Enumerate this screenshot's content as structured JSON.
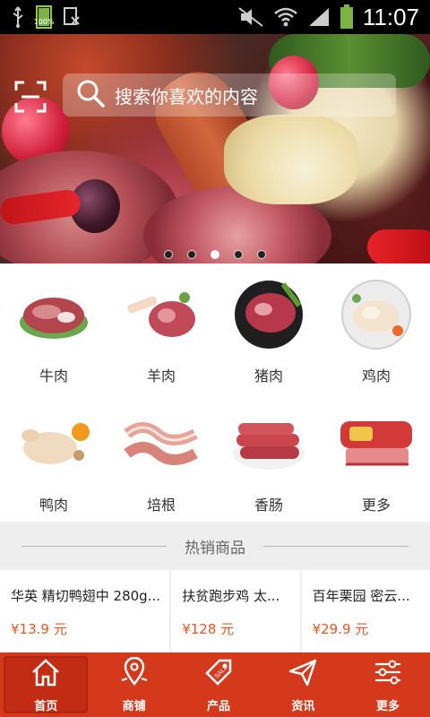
{
  "status_bar": {
    "battery": "100%",
    "time": "11:07",
    "icons": [
      "usb-icon",
      "battery-icon",
      "doc-icon",
      "mute-icon",
      "wifi-icon",
      "signal-icon",
      "battery-icon"
    ]
  },
  "search": {
    "placeholder": "搜索你喜欢的内容"
  },
  "banner": {
    "slide_count": 5,
    "active_slide": 3
  },
  "categories": [
    {
      "label": "牛肉",
      "icon": "beef-image"
    },
    {
      "label": "羊肉",
      "icon": "lamb-image"
    },
    {
      "label": "猪肉",
      "icon": "pork-image"
    },
    {
      "label": "鸡肉",
      "icon": "chicken-image"
    },
    {
      "label": "鸭肉",
      "icon": "duck-image"
    },
    {
      "label": "培根",
      "icon": "bacon-image"
    },
    {
      "label": "香肠",
      "icon": "sausage-image"
    },
    {
      "label": "更多",
      "icon": "more-image"
    }
  ],
  "hot": {
    "title": "热销商品",
    "products": [
      {
        "name": "华英 精切鸭翅中 280g...",
        "price": "¥13.9 元"
      },
      {
        "name": "扶贫跑步鸡 太...",
        "price": "¥128 元"
      },
      {
        "name": "百年栗园 密云...",
        "price": "¥29.9 元"
      }
    ]
  },
  "nav": [
    {
      "label": "首页",
      "icon": "home-icon",
      "active": true
    },
    {
      "label": "商铺",
      "icon": "store-map-icon"
    },
    {
      "label": "产品",
      "icon": "sale-tag-icon"
    },
    {
      "label": "资讯",
      "icon": "send-icon"
    },
    {
      "label": "更多",
      "icon": "settings-sliders-icon"
    }
  ],
  "colors": {
    "accent": "#d4391c",
    "price": "#e8561e"
  }
}
